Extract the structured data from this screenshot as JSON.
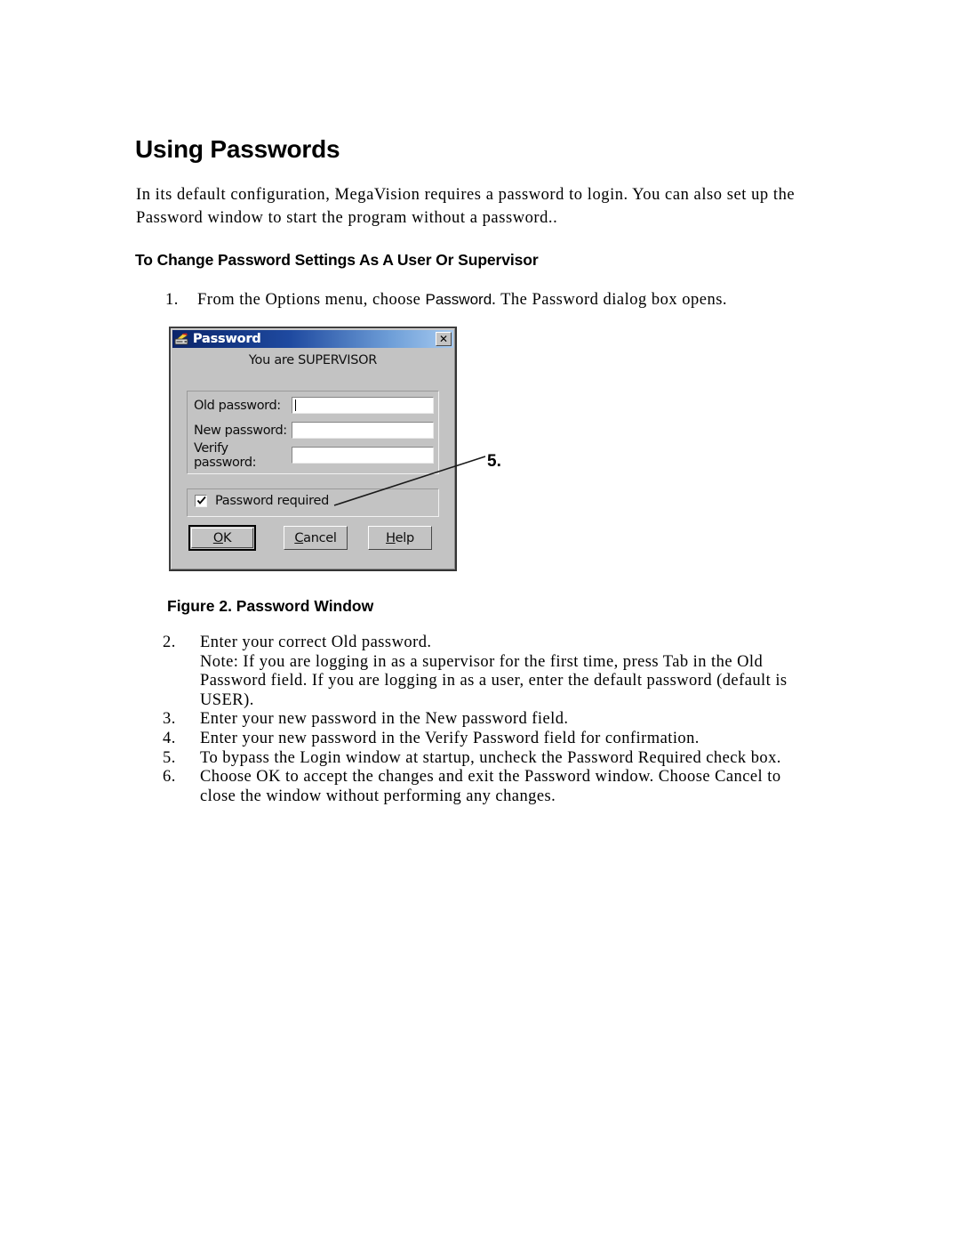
{
  "document": {
    "heading": "Using Passwords",
    "intro": "In its default configuration, MegaVision requires a password to login. You can also set up the Password window to start the program without a password..",
    "subheading": "To Change Password Settings As A User Or Supervisor",
    "step1": {
      "number": "1.",
      "text_before": "From the Options menu, choose ",
      "emphasis": "Password",
      "text_after": ". The Password dialog box opens."
    },
    "figure_caption": "Figure 2. Password Window",
    "callout": "5.",
    "steps": [
      {
        "number": "2.",
        "lines": [
          "Enter your correct Old password.",
          "Note: If you are logging in as a supervisor for the first time, press Tab in the Old",
          "Password field. If you are logging in as a user, enter the default password (default is",
          "USER)."
        ]
      },
      {
        "number": "3.",
        "lines": [
          "Enter your new password in the New password field."
        ]
      },
      {
        "number": "4.",
        "lines": [
          "Enter your new password in the Verify Password field for confirmation."
        ]
      },
      {
        "number": "5.",
        "lines": [
          "To bypass the Login window at startup, uncheck the Password Required check box."
        ]
      },
      {
        "number": "6.",
        "lines": [
          "Choose OK to accept the changes and exit the Password window. Choose Cancel to",
          "close the window without performing any changes."
        ]
      }
    ]
  },
  "dialog": {
    "title": "Password",
    "title_icon": "scanner-icon",
    "close_label": "✕",
    "status_text": "You are SUPERVISOR",
    "fields": [
      {
        "label": "Old password:",
        "value": "",
        "focused": true
      },
      {
        "label": "New password:",
        "value": "",
        "focused": false
      },
      {
        "label": "Verify password:",
        "value": "",
        "focused": false
      }
    ],
    "checkbox": {
      "label": "Password required",
      "checked": true
    },
    "buttons": [
      {
        "label": "OK",
        "accel": "O",
        "rest": "K",
        "default": true
      },
      {
        "label": "Cancel",
        "accel": "C",
        "rest": "ancel",
        "default": false
      },
      {
        "label": "Help",
        "accel": "H",
        "rest": "elp",
        "default": false
      }
    ]
  },
  "colors": {
    "title_gradient_start": "#0a246a",
    "title_gradient_end": "#a6caf0",
    "dialog_face": "#c3c3c3",
    "field_bg": "#ffffff",
    "text": "#000000"
  }
}
